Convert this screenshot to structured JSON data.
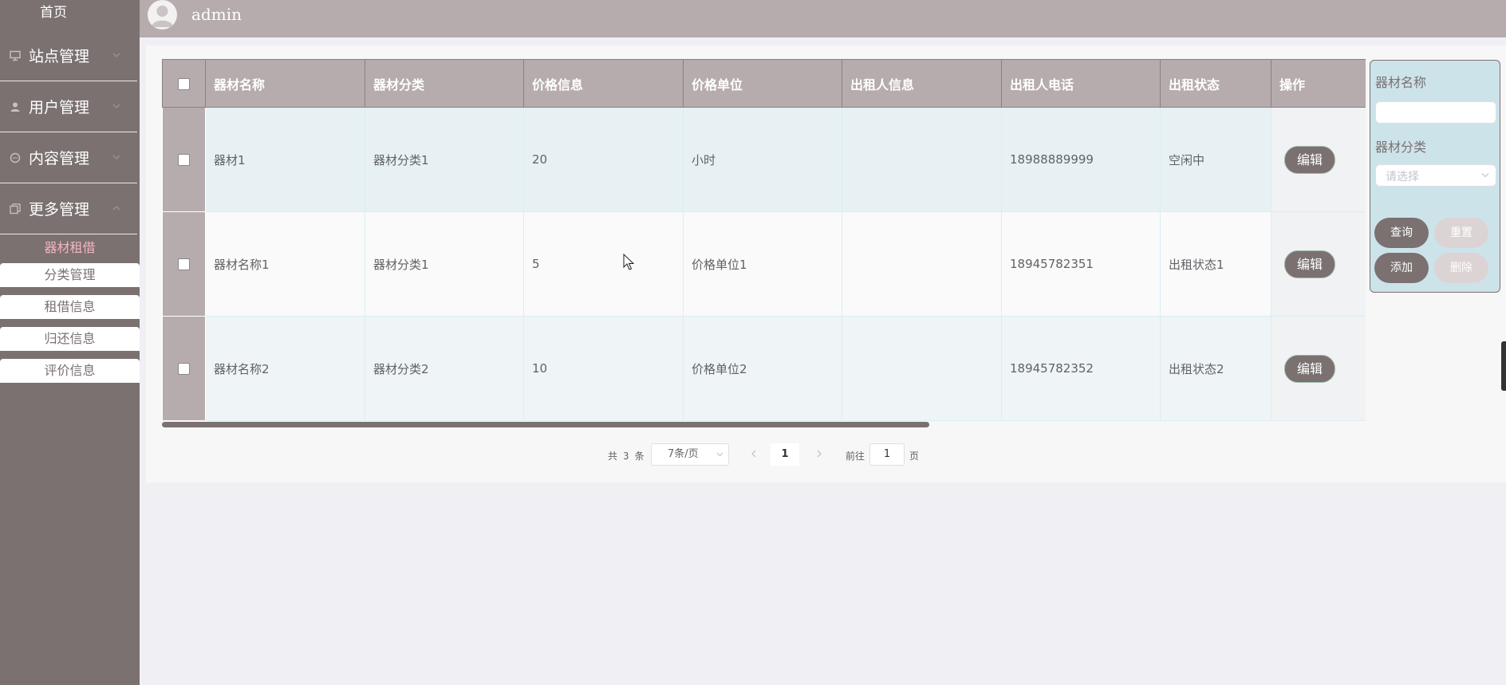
{
  "sidebar": {
    "home": "首页",
    "groups": [
      {
        "label": "站点管理",
        "icon": "monitor-icon",
        "expanded": false
      },
      {
        "label": "用户管理",
        "icon": "user-icon",
        "expanded": false
      },
      {
        "label": "内容管理",
        "icon": "chat-icon",
        "expanded": false
      },
      {
        "label": "更多管理",
        "icon": "copy-icon",
        "expanded": true
      }
    ],
    "active_item": "器材租借",
    "sub_items": [
      "分类管理",
      "租借信息",
      "归还信息",
      "评价信息"
    ]
  },
  "header": {
    "username": "admin"
  },
  "table": {
    "columns": [
      "器材名称",
      "器材分类",
      "价格信息",
      "价格单位",
      "出租人信息",
      "出租人电话",
      "出租状态",
      "操作"
    ],
    "rows": [
      {
        "name": "器材1",
        "category": "器材分类1",
        "price": "20",
        "unit": "小时",
        "renter": "",
        "phone": "18988889999",
        "status": "空闲中",
        "action": "编辑"
      },
      {
        "name": "器材名称1",
        "category": "器材分类1",
        "price": "5",
        "unit": "价格单位1",
        "renter": "",
        "phone": "18945782351",
        "status": "出租状态1",
        "action": "编辑"
      },
      {
        "name": "器材名称2",
        "category": "器材分类2",
        "price": "10",
        "unit": "价格单位2",
        "renter": "",
        "phone": "18945782352",
        "status": "出租状态2",
        "action": "编辑"
      }
    ]
  },
  "pagination": {
    "total": "共 3 条",
    "page_size": "7条/页",
    "current_page": "1",
    "goto_label": "前往",
    "goto_value": "1",
    "page_suffix": "页"
  },
  "search": {
    "name_label": "器材名称",
    "category_label": "器材分类",
    "category_placeholder": "请选择",
    "query_btn": "查询",
    "reset_btn": "重置",
    "add_btn": "添加",
    "delete_btn": "删除"
  },
  "colors": {
    "sidebar": "#7a7170",
    "header": "#b6acad",
    "accent_pink": "#f7b4c0",
    "panel": "#cde3ea"
  }
}
